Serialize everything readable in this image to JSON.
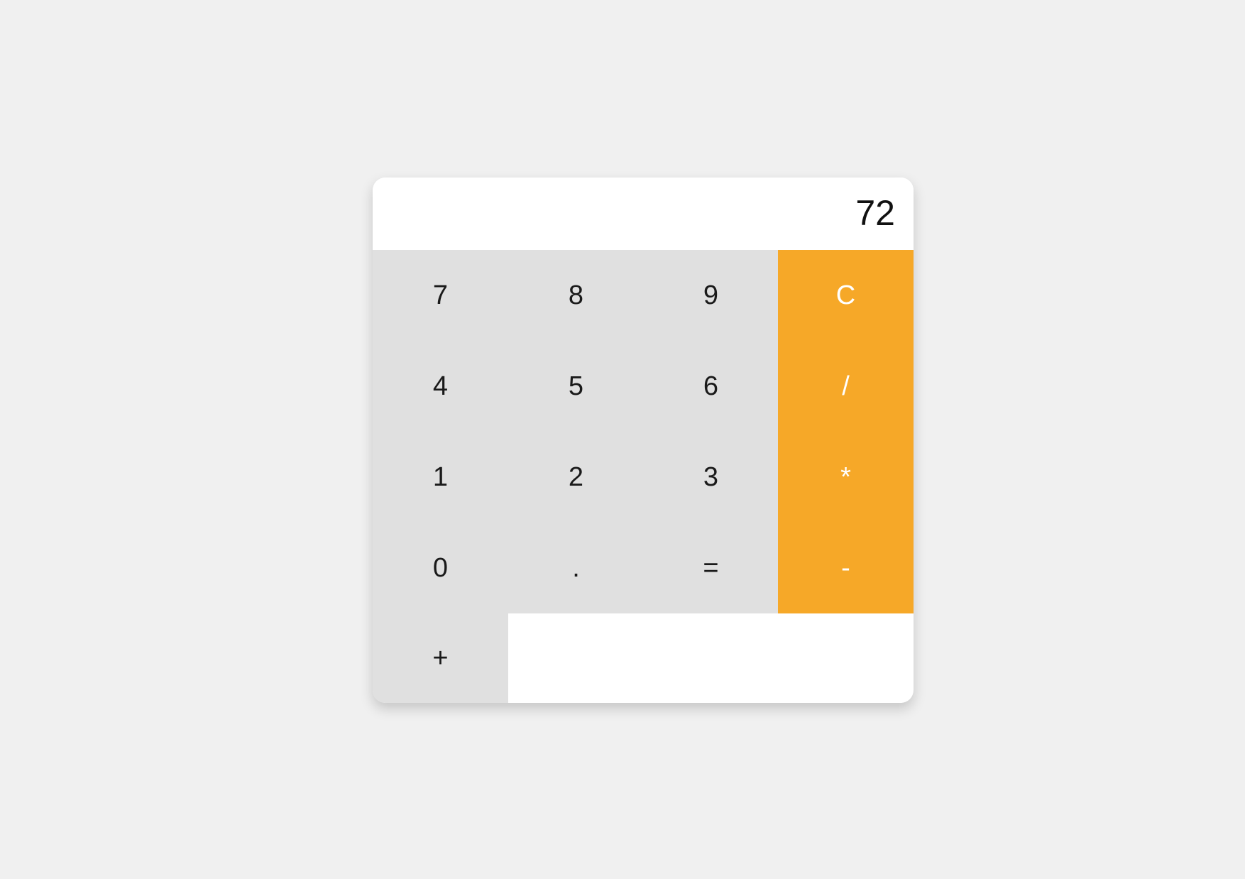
{
  "display": {
    "value": "72"
  },
  "keys": {
    "seven": "7",
    "eight": "8",
    "nine": "9",
    "clear": "C",
    "four": "4",
    "five": "5",
    "six": "6",
    "divide": "/",
    "one": "1",
    "two": "2",
    "three": "3",
    "multiply": "*",
    "zero": "0",
    "decimal": ".",
    "equals": "=",
    "subtract": "-",
    "add": "+"
  },
  "colors": {
    "operator_key": "#f6a828",
    "number_key": "#e0e0e0",
    "background": "#f0f0f0"
  }
}
